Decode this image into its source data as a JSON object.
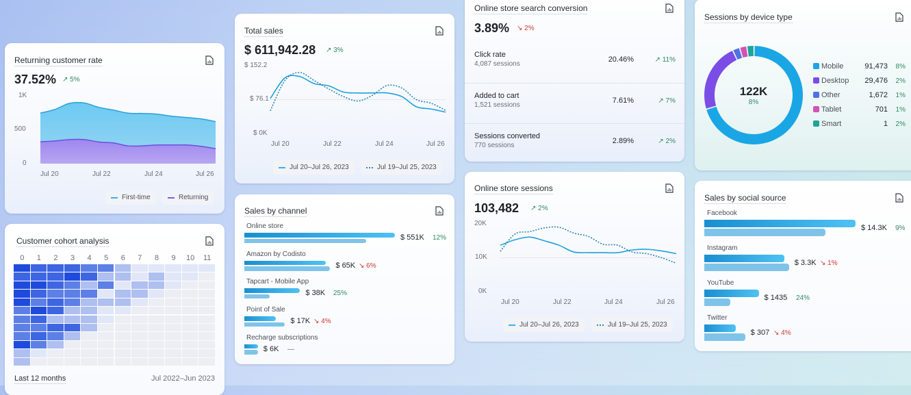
{
  "colors": {
    "first_time": "#5cc3ef",
    "returning": "#a48bef",
    "line_current": "#1fa1d8",
    "line_previous": "#2a86b8",
    "up": "#2f8a5f",
    "down": "#d0362c",
    "cohort_levels": [
      "#eceef3",
      "#e1e7f7",
      "#aebff0",
      "#5d80e6",
      "#3e66e2",
      "#1f4bdc"
    ]
  },
  "returning_customer_rate": {
    "title": "Returning customer rate",
    "value": "37.52%",
    "change": "5%",
    "change_dir": "up",
    "y_ticks": [
      "1K",
      "500",
      "0"
    ],
    "x_ticks": [
      "Jul 20",
      "Jul 22",
      "Jul 24",
      "Jul 26"
    ],
    "legend": [
      "First-time",
      "Returning"
    ]
  },
  "cohort": {
    "title": "Customer cohort analysis",
    "columns": [
      "0",
      "1",
      "2",
      "3",
      "4",
      "5",
      "6",
      "7",
      "8",
      "9",
      "10",
      "11"
    ],
    "footer_left": "Last 12 months",
    "footer_right": "Jul 2022–Jun 2023",
    "levels": [
      [
        5,
        4,
        4,
        4,
        3,
        3,
        2,
        1,
        1,
        1,
        1,
        1
      ],
      [
        4,
        4,
        4,
        5,
        4,
        2,
        2,
        1,
        2,
        1,
        1,
        0
      ],
      [
        5,
        5,
        4,
        3,
        2,
        3,
        1,
        2,
        2,
        1,
        0,
        0
      ],
      [
        5,
        4,
        3,
        3,
        3,
        1,
        2,
        2,
        1,
        0,
        0,
        0
      ],
      [
        5,
        3,
        4,
        3,
        2,
        2,
        2,
        1,
        0,
        0,
        0,
        0
      ],
      [
        3,
        5,
        4,
        2,
        2,
        1,
        1,
        0,
        0,
        0,
        0,
        0
      ],
      [
        3,
        4,
        2,
        2,
        2,
        1,
        0,
        0,
        0,
        0,
        0,
        0
      ],
      [
        3,
        3,
        4,
        4,
        2,
        0,
        0,
        0,
        0,
        0,
        0,
        0
      ],
      [
        3,
        4,
        3,
        2,
        0,
        0,
        0,
        0,
        0,
        0,
        0,
        0
      ],
      [
        5,
        3,
        2,
        0,
        0,
        0,
        0,
        0,
        0,
        0,
        0,
        0
      ],
      [
        2,
        1,
        0,
        0,
        0,
        0,
        0,
        0,
        0,
        0,
        0,
        0
      ],
      [
        2,
        0,
        0,
        0,
        0,
        0,
        0,
        0,
        0,
        0,
        0,
        0
      ]
    ]
  },
  "total_sales": {
    "title": "Total sales",
    "value": "$ 611,942.28",
    "change": "3%",
    "change_dir": "up",
    "y_ticks": [
      "$ 152.2",
      "$ 76.1",
      "$ 0K"
    ],
    "x_ticks": [
      "Jul 20",
      "Jul 22",
      "Jul 24",
      "Jul 26"
    ],
    "legend": [
      "Jul 20–Jul 26, 2023",
      "Jul 19–Jul 25, 2023"
    ]
  },
  "sales_by_channel": {
    "title": "Sales by channel",
    "items": [
      {
        "label": "Online store",
        "value": "$ 551K",
        "change": "12%",
        "change_dir": "flat-up",
        "current_bar": 1.0,
        "previous_bar": 0.81
      },
      {
        "label": "Amazon by Codisto",
        "value": "$ 65K",
        "change": "6%",
        "change_dir": "down",
        "current_bar": 0.54,
        "previous_bar": 0.57
      },
      {
        "label": "Tapcart - Mobile App",
        "value": "$ 38K",
        "change": "25%",
        "change_dir": "flat-up",
        "current_bar": 0.37,
        "previous_bar": 0.17
      },
      {
        "label": "Point of Sale",
        "value": "$ 17K",
        "change": "4%",
        "change_dir": "down",
        "current_bar": 0.21,
        "previous_bar": 0.27
      },
      {
        "label": "Recharge subscriptions",
        "value": "$ 6K",
        "change": "—",
        "change_dir": "none",
        "current_bar": 0.09,
        "previous_bar": 0.09
      }
    ]
  },
  "search_conversion": {
    "title": "Online store search conversion",
    "value": "3.89%",
    "change": "2%",
    "change_dir": "down",
    "rows": [
      {
        "label": "Click rate",
        "sub": "4,087 sessions",
        "value": "20.46%",
        "change": "11%"
      },
      {
        "label": "Added to cart",
        "sub": "1,521 sessions",
        "value": "7.61%",
        "change": "7%"
      },
      {
        "label": "Sessions converted",
        "sub": "770 sessions",
        "value": "2.89%",
        "change": "2%"
      }
    ]
  },
  "store_sessions": {
    "title": "Online store sessions",
    "value": "103,482",
    "change": "2%",
    "change_dir": "up",
    "y_ticks": [
      "20K",
      "10K",
      "0K"
    ],
    "x_ticks": [
      "Jul 20",
      "Jul 22",
      "Jul 24",
      "Jul 26"
    ],
    "legend": [
      "Jul 20–Jul 26, 2023",
      "Jul 19–Jul 25, 2023"
    ]
  },
  "device_sessions": {
    "title": "Sessions by device type",
    "total": "122K",
    "total_change": "8%",
    "items": [
      {
        "label": "Mobile",
        "value": "91,473",
        "raw": 91473,
        "change": "8%",
        "color": "#1aa6e4"
      },
      {
        "label": "Desktop",
        "value": "29,476",
        "raw": 29476,
        "change": "2%",
        "color": "#7a4ee6"
      },
      {
        "label": "Other",
        "value": "1,672",
        "raw": 1672,
        "change": "1%",
        "color": "#4f72e3"
      },
      {
        "label": "Tablet",
        "value": "701",
        "raw": 701,
        "change": "1%",
        "color": "#d154b4"
      },
      {
        "label": "Smart",
        "value": "1",
        "raw": 1,
        "change": "2%",
        "color": "#20a39b"
      }
    ]
  },
  "sales_by_social": {
    "title": "Sales by social source",
    "items": [
      {
        "label": "Facebook",
        "value": "$ 14.3K",
        "change": "9%",
        "change_dir": "flat-up",
        "current_bar": 1.0,
        "previous_bar": 0.8
      },
      {
        "label": "Instagram",
        "value": "$ 3.3K",
        "change": "1%",
        "change_dir": "down",
        "current_bar": 0.53,
        "previous_bar": 0.56
      },
      {
        "label": "YouTube",
        "value": "$ 1435",
        "change": "24%",
        "change_dir": "flat-up",
        "current_bar": 0.36,
        "previous_bar": 0.17
      },
      {
        "label": "Twitter",
        "value": "$ 307",
        "change": "4%",
        "change_dir": "down",
        "current_bar": 0.21,
        "previous_bar": 0.27
      }
    ]
  },
  "chart_data": [
    {
      "type": "area",
      "stacked": true,
      "title": "Returning customer rate",
      "x": [
        "Jul 20",
        "",
        "Jul 21",
        "",
        "Jul 22",
        "",
        "Jul 23",
        "",
        "Jul 24",
        "",
        "Jul 25",
        "",
        "Jul 26"
      ],
      "ylim": [
        0,
        1000
      ],
      "series": [
        {
          "name": "Returning",
          "values": [
            322,
            335,
            355,
            355,
            320,
            305,
            262,
            262,
            275,
            275,
            275,
            255,
            220
          ]
        },
        {
          "name": "First-time",
          "values": [
            423,
            465,
            535,
            540,
            510,
            485,
            483,
            478,
            455,
            425,
            405,
            405,
            400
          ]
        }
      ]
    },
    {
      "type": "line",
      "title": "Total sales",
      "x": [
        "Jul 20",
        "",
        "Jul 21",
        "",
        "Jul 22",
        "",
        "Jul 23",
        "",
        "Jul 24",
        "",
        "Jul 25",
        "",
        "Jul 26"
      ],
      "ylim": [
        0,
        152.2
      ],
      "series": [
        {
          "name": "Jul 20–Jul 26, 2023",
          "values": [
            78.7,
            125,
            128,
            112,
            107,
            93,
            91,
            91,
            91,
            83,
            60,
            55,
            48
          ]
        },
        {
          "name": "Jul 19–Jul 25, 2023",
          "values": [
            51,
            119,
            137,
            119,
            100,
            83,
            73,
            86,
            108,
            102,
            76,
            68,
            52
          ]
        }
      ]
    },
    {
      "type": "line",
      "title": "Online store sessions",
      "x": [
        "Jul 20",
        "",
        "Jul 21",
        "",
        "Jul 22",
        "",
        "Jul 23",
        "",
        "Jul 24",
        "",
        "Jul 25",
        "",
        "Jul 26"
      ],
      "ylim": [
        0,
        20000
      ],
      "series": [
        {
          "name": "Jul 20–Jul 26, 2023",
          "values": [
            13700,
            15300,
            16100,
            15000,
            13700,
            11700,
            11500,
            11500,
            11500,
            12300,
            12500,
            12000,
            11200
          ]
        },
        {
          "name": "Jul 19–Jul 25, 2023",
          "values": [
            11900,
            17000,
            17700,
            18800,
            19000,
            17300,
            16300,
            14000,
            13700,
            11700,
            11200,
            10000,
            8400
          ]
        }
      ]
    },
    {
      "type": "pie",
      "title": "Sessions by device type",
      "categories": [
        "Mobile",
        "Desktop",
        "Other",
        "Tablet",
        "Smart"
      ],
      "values": [
        91473,
        29476,
        1672,
        701,
        1
      ]
    }
  ]
}
